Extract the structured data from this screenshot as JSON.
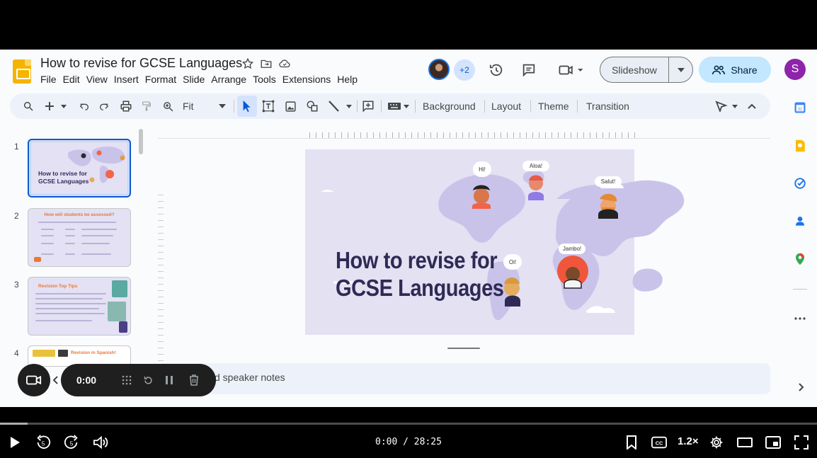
{
  "document": {
    "title": "How to revise for GCSE Languages",
    "menu": [
      "File",
      "Edit",
      "View",
      "Insert",
      "Format",
      "Slide",
      "Arrange",
      "Tools",
      "Extensions",
      "Help"
    ]
  },
  "header": {
    "collaborators_badge": "+2",
    "slideshow_label": "Slideshow",
    "share_label": "Share",
    "user_initial": "S"
  },
  "toolbar": {
    "zoom_label": "Fit",
    "background_label": "Background",
    "layout_label": "Layout",
    "theme_label": "Theme",
    "transition_label": "Transition"
  },
  "filmstrip": {
    "slides": [
      {
        "number": "1",
        "title": "How to revise for GCSE Languages"
      },
      {
        "number": "2",
        "title": "How will students be assessed?"
      },
      {
        "number": "3",
        "title": "Revision Top Tips"
      },
      {
        "number": "4",
        "title": "Revision in Spanish!"
      }
    ]
  },
  "slide": {
    "title_line1": "How to revise for",
    "title_line2": "GCSE Languages",
    "greetings": [
      "Hi!",
      "Aloa!",
      "Salut!",
      "Oi!",
      "Jambo!"
    ]
  },
  "notes": {
    "placeholder_text": "d speaker notes"
  },
  "recorder": {
    "time": "0:00"
  },
  "player": {
    "time_display": "0:00 / 28:25",
    "speed": "1.2×",
    "progress_fraction": 0.034,
    "skip_seconds": "5"
  },
  "colors": {
    "accent_blue": "#0b57d0",
    "share_bg": "#c2e7ff",
    "slide_bg": "#e3e1f2",
    "map_purple": "#c9c3ea",
    "title_navy": "#2f2a55",
    "user_avatar": "#8e24aa"
  }
}
